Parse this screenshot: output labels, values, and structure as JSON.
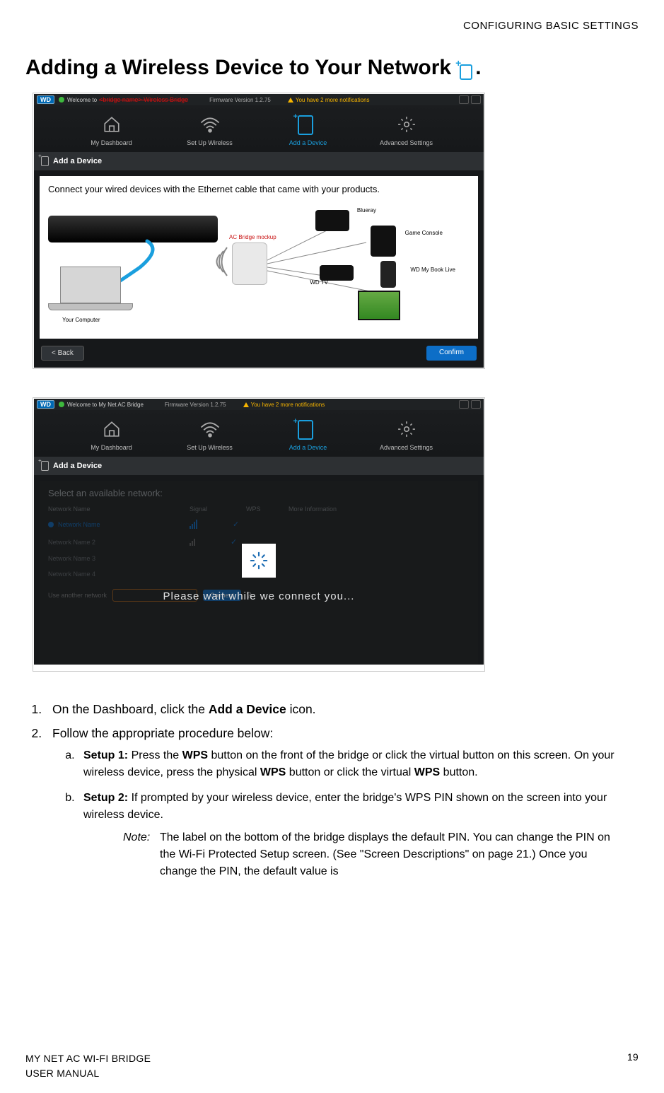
{
  "header": {
    "section": "CONFIGURING BASIC SETTINGS"
  },
  "title": "Adding a Wireless Device to Your Network",
  "title_period": ".",
  "shot1": {
    "wd": "WD",
    "welcome_prefix": "Welcome to",
    "bridge_placeholder": "<bridge name> Wireless Bridge",
    "firmware": "Firmware Version 1.2.75",
    "notifications": "You have 2 more notifications",
    "nav": [
      "My Dashboard",
      "Set Up Wireless",
      "Add a Device",
      "Advanced Settings"
    ],
    "tab_label": "Add a Device",
    "panel_text": "Connect your wired devices with the Ethernet cable that came with your products.",
    "diagram_labels": {
      "your_computer": "Your Computer",
      "ac_bridge": "AC Bridge mockup",
      "blueray": "Blueray",
      "game_console": "Game Console",
      "wd_tv": "WD TV",
      "mybook": "WD My Book Live"
    },
    "back": "< Back",
    "confirm": "Confirm"
  },
  "shot2": {
    "wd": "WD",
    "welcome": "Welcome to My Net AC Bridge",
    "firmware": "Firmware Version 1.2.75",
    "notifications": "You have 2 more notifications",
    "nav": [
      "My Dashboard",
      "Set Up Wireless",
      "Add a Device",
      "Advanced Settings"
    ],
    "tab_label": "Add a Device",
    "select_label": "Select an available network:",
    "cols": [
      "Network Name",
      "Signal",
      "WPS",
      "More Information"
    ],
    "rows": [
      "Network Name",
      "Network Name 2",
      "Network Name 3",
      "Network Name 4"
    ],
    "use_another": "Use another network",
    "connect": "Connect",
    "overlay": "Please wait while we connect you..."
  },
  "step1_a": "On the Dashboard, click the ",
  "step1_b": "Add a Device",
  "step1_c": " icon.",
  "step2": "Follow the appropriate procedure below:",
  "sub_a_label": "Setup 1:",
  "sub_a_1": " Press the ",
  "sub_a_wps": "WPS",
  "sub_a_2": " button on the front of the bridge or click the virtual button on this screen. On your wireless device, press the physical ",
  "sub_a_3": " button or click the virtual ",
  "sub_a_4": " button.",
  "sub_b_label": "Setup 2:",
  "sub_b_1": " If prompted by your wireless device, enter the bridge's WPS PIN shown on the screen into your wireless device.",
  "note_label": "Note:",
  "note_body": "The label on the bottom of the bridge displays the default PIN. You can change the PIN on the Wi-Fi Protected Setup screen. (See \"Screen Descriptions\" on page 21.) Once you change the PIN, the default value is",
  "footer": {
    "line1": "MY NET AC WI-FI BRIDGE",
    "line2": "USER MANUAL",
    "page": "19"
  }
}
